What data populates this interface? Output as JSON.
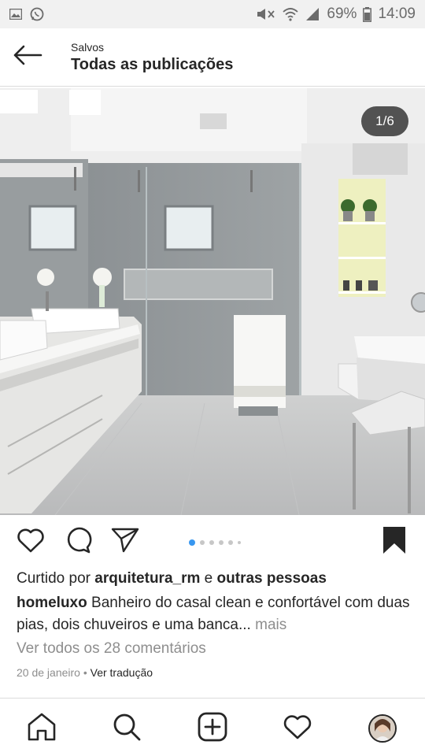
{
  "status_bar": {
    "battery": "69%",
    "time": "14:09",
    "icons": [
      "image-icon",
      "whatsapp-icon",
      "mute-icon",
      "wifi-icon",
      "signal-icon",
      "battery-icon"
    ]
  },
  "header": {
    "subtitle": "Salvos",
    "title": "Todas as publicações",
    "back_icon": "back-arrow-icon"
  },
  "post": {
    "image_counter": "1/6",
    "carousel": {
      "total": 6,
      "active": 1
    },
    "actions": [
      "heart-icon",
      "comment-icon",
      "share-icon",
      "bookmark-icon"
    ],
    "likes": {
      "prefix": "Curtido por",
      "user": "arquitetura_rm",
      "conj": "e",
      "others": "outras pessoas"
    },
    "caption": {
      "username": "homeluxo",
      "text": "Banheiro do casal clean e confortável com duas pias, dois chuveiros e uma banca...",
      "more": "mais"
    },
    "comments_link": "Ver todos os 28 comentários",
    "date": "20 de janeiro",
    "separator": "•",
    "translate": "Ver tradução"
  },
  "bottom_nav": [
    "home-icon",
    "search-icon",
    "new-post-icon",
    "activity-heart-icon",
    "profile-avatar"
  ],
  "colors": {
    "accent": "#3897f0",
    "text": "#262626",
    "muted": "#8e8e8e"
  }
}
